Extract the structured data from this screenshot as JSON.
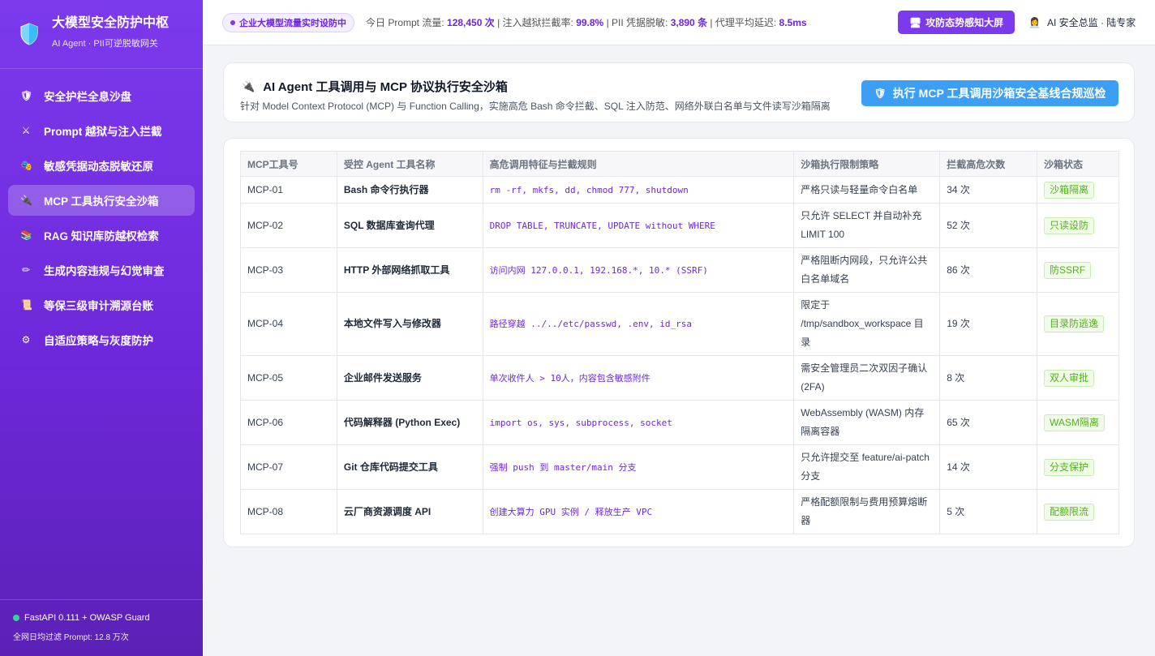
{
  "sidebar": {
    "brand_title": "大模型安全防护中枢",
    "brand_sub": "AI Agent · PII可逆脱敏网关",
    "items": [
      {
        "icon": "🛡",
        "label": "安全护栏全息沙盘",
        "active": false
      },
      {
        "icon": "⚔",
        "label": "Prompt 越狱与注入拦截",
        "active": false
      },
      {
        "icon": "🎭",
        "label": "敏感凭据动态脱敏还原",
        "active": false
      },
      {
        "icon": "🔌",
        "label": "MCP 工具执行安全沙箱",
        "active": true
      },
      {
        "icon": "📚",
        "label": "RAG 知识库防越权检索",
        "active": false
      },
      {
        "icon": "✏",
        "label": "生成内容违规与幻觉审查",
        "active": false
      },
      {
        "icon": "📜",
        "label": "等保三级审计溯源台账",
        "active": false
      },
      {
        "icon": "⚙",
        "label": "自适应策略与灰度防护",
        "active": false
      }
    ],
    "footer_status": "FastAPI 0.111 + OWASP Guard",
    "footer_stat": "全网日均过滤 Prompt: 12.8 万次"
  },
  "topbar": {
    "live_badge": "企业大模型流量实时设防中",
    "stats_prompt_label": "今日 Prompt 流量: ",
    "stats_prompt_value": "128,450 次",
    "stats_jailbreak_label": " | 注入越狱拦截率: ",
    "stats_jailbreak_value": "99.8%",
    "stats_pii_label": " | PII 凭据脱敏: ",
    "stats_pii_value": "3,890 条",
    "stats_latency_label": " | 代理平均延迟: ",
    "stats_latency_value": "8.5ms",
    "situation_button": "攻防态势感知大屏",
    "user": "AI 安全总监 · 陆专家"
  },
  "header": {
    "title": "AI Agent 工具调用与 MCP 协议执行安全沙箱",
    "description": "针对 Model Context Protocol (MCP) 与 Function Calling，实施高危 Bash 命令拦截、SQL 注入防范、网络外联白名单与文件读写沙箱隔离",
    "patrol_button": "执行 MCP 工具调用沙箱安全基线合规巡检"
  },
  "table": {
    "columns": [
      "MCP工具号",
      "受控 Agent 工具名称",
      "高危调用特征与拦截规则",
      "沙箱执行限制策略",
      "拦截高危次数",
      "沙箱状态"
    ],
    "rows": [
      {
        "id": "MCP-01",
        "tool": "Bash 命令行执行器",
        "rule": "rm -rf, mkfs, dd, chmod 777, shutdown",
        "policy": "严格只读与轻量命令白名单",
        "count": "34 次",
        "status": "沙箱隔离"
      },
      {
        "id": "MCP-02",
        "tool": "SQL 数据库查询代理",
        "rule": "DROP TABLE, TRUNCATE, UPDATE without WHERE",
        "policy": "只允许 SELECT 并自动补充 LIMIT 100",
        "count": "52 次",
        "status": "只读设防"
      },
      {
        "id": "MCP-03",
        "tool": "HTTP 外部网络抓取工具",
        "rule": "访问内网 127.0.0.1, 192.168.*, 10.* (SSRF)",
        "policy": "严格阻断内网段，只允许公共白名单域名",
        "count": "86 次",
        "status": "防SSRF"
      },
      {
        "id": "MCP-04",
        "tool": "本地文件写入与修改器",
        "rule": "路径穿越 ../../etc/passwd, .env, id_rsa",
        "policy": "限定于 /tmp/sandbox_workspace 目录",
        "count": "19 次",
        "status": "目录防逃逸"
      },
      {
        "id": "MCP-05",
        "tool": "企业邮件发送服务",
        "rule": "单次收件人 > 10人，内容包含敏感附件",
        "policy": "需安全管理员二次双因子确认 (2FA)",
        "count": "8 次",
        "status": "双人审批"
      },
      {
        "id": "MCP-06",
        "tool": "代码解释器 (Python Exec)",
        "rule": "import os, sys, subprocess, socket",
        "policy": "WebAssembly (WASM) 内存隔离容器",
        "count": "65 次",
        "status": "WASM隔离"
      },
      {
        "id": "MCP-07",
        "tool": "Git 仓库代码提交工具",
        "rule": "强制 push 到 master/main 分支",
        "policy": "只允许提交至 feature/ai-patch 分支",
        "count": "14 次",
        "status": "分支保护"
      },
      {
        "id": "MCP-08",
        "tool": "云厂商资源调度 API",
        "rule": "创建大算力 GPU 实例 / 释放生产 VPC",
        "policy": "严格配额限制与费用预算熔断器",
        "count": "5 次",
        "status": "配额限流"
      }
    ]
  },
  "colors": {
    "accent": "#7c3aed",
    "button_blue": "#3b9ff6",
    "tag_green": "#52b11c"
  }
}
